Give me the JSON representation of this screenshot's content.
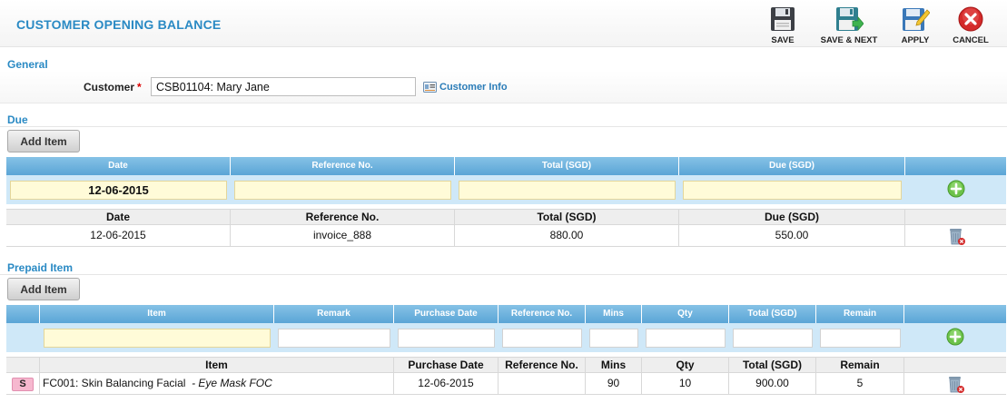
{
  "header": {
    "title": "CUSTOMER OPENING BALANCE",
    "buttons": {
      "save": "SAVE",
      "save_next": "SAVE & NEXT",
      "apply": "APPLY",
      "cancel": "CANCEL"
    }
  },
  "general": {
    "section_title": "General",
    "customer_label": "Customer",
    "required_mark": "*",
    "customer_value": "CSB01104: Mary Jane",
    "customer_info_link": "Customer Info"
  },
  "due": {
    "section_title": "Due",
    "add_button": "Add Item",
    "columns": [
      "Date",
      "Reference No.",
      "Total (SGD)",
      "Due (SGD)"
    ],
    "new_row": {
      "date": "12-06-2015"
    },
    "rows": [
      {
        "date": "12-06-2015",
        "reference": "invoice_888",
        "total": "880.00",
        "due": "550.00"
      }
    ]
  },
  "prepaid": {
    "section_title": "Prepaid Item",
    "add_button": "Add Item",
    "columns": [
      "Item",
      "Remark",
      "Purchase Date",
      "Reference No.",
      "Mins",
      "Qty",
      "Total (SGD)",
      "Remain"
    ],
    "rows": [
      {
        "type_badge": "S",
        "item": "FC001: Skin Balancing Facial",
        "remark": "- Eye Mask FOC",
        "purchase_date": "12-06-2015",
        "reference": "",
        "mins": "90",
        "qty": "10",
        "total": "900.00",
        "remain": "5"
      }
    ]
  },
  "icons": {
    "save": "floppy-disk-icon",
    "save_next": "floppy-disk-arrow-icon",
    "apply": "floppy-disk-pencil-icon",
    "cancel": "red-x-circle-icon",
    "add": "green-plus-circle-icon",
    "delete": "trash-bin-icon",
    "customer_info": "id-card-icon"
  },
  "colors": {
    "accent": "#2a8ac4",
    "grid_header": "#5aa5d6",
    "input_row": "#cfe8f8",
    "date_input": "#fffbd8",
    "badge": "#f6b8cf"
  }
}
